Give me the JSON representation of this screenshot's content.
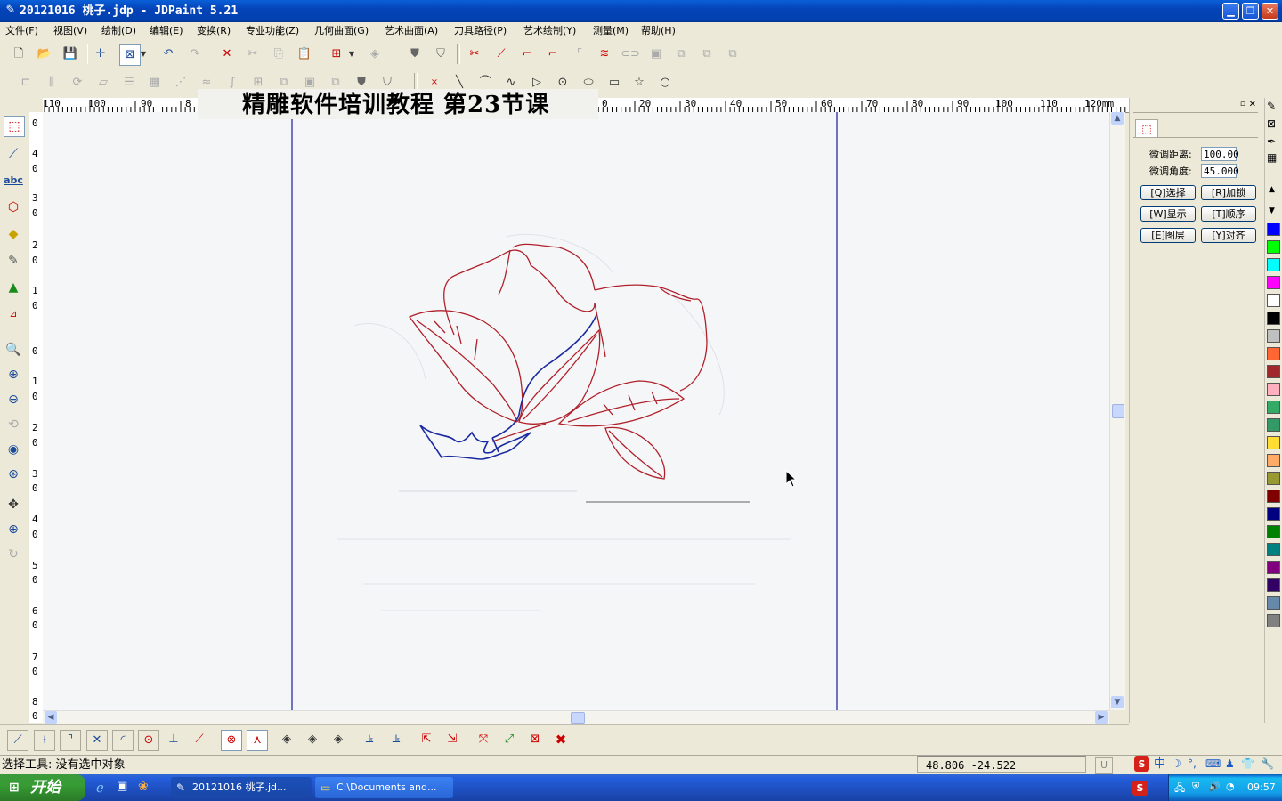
{
  "window": {
    "title": "20121016 桃子.jdp - JDPaint 5.21",
    "minimize_icon": "minimize-icon",
    "maximize_icon": "restore-icon",
    "close_icon": "close-icon"
  },
  "menu": [
    "文件(F)",
    "视图(V)",
    "绘制(D)",
    "编辑(E)",
    "变换(R)",
    "专业功能(Z)",
    "几何曲面(G)",
    "艺术曲面(A)",
    "刀具路径(P)",
    "艺术绘制(Y)",
    "测量(M)",
    "帮助(H)"
  ],
  "banner": {
    "text": "精雕软件培训教程  第23节课"
  },
  "hruler": {
    "labels": [
      "110",
      "100",
      "90",
      "8",
      "0",
      "20",
      "30",
      "40",
      "50",
      "60",
      "70",
      "80",
      "90",
      "100",
      "110",
      "120mm"
    ]
  },
  "vruler": {
    "labels": [
      "0",
      "4",
      "0",
      "3",
      "0",
      "2",
      "0",
      "1",
      "0",
      "0",
      "1",
      "0",
      "2",
      "0",
      "3",
      "0",
      "4",
      "0",
      "5",
      "0",
      "6",
      "0",
      "7",
      "0",
      "8",
      "0"
    ]
  },
  "right_panel": {
    "tab_icon": "select-node-icon",
    "fine_distance_label": "微调距离:",
    "fine_distance_value": "100.00",
    "fine_angle_label": "微调角度:",
    "fine_angle_value": "45.000",
    "buttons": [
      "[Q]选择",
      "[R]加锁",
      "[W]显示",
      "[T]顺序",
      "[E]图层",
      "[Y]对齐"
    ]
  },
  "palette": {
    "colors": [
      "#0000ff",
      "#ffffff",
      "#ff0000",
      "#ffff00",
      "#0000ff",
      "#00ff00",
      "#00ffff",
      "#ff00ff",
      "#ffffff",
      "#000000",
      "#c0c0c0",
      "#ff6633",
      "#a0282d",
      "#ffb0c0",
      "#33aa66",
      "#339966",
      "#ffdd33",
      "#ffaa66",
      "#999933",
      "#800000",
      "#000080",
      "#008000",
      "#008080",
      "#800080",
      "#330066",
      "#6688aa",
      "#808080"
    ]
  },
  "status": {
    "text": "选择工具: 没有选中对象",
    "coords": "48.806  -24.522"
  },
  "taskbar": {
    "start": "开始",
    "tasks": [
      "20121016 桃子.jd...",
      "C:\\Documents and..."
    ],
    "clock": "09:57"
  },
  "colors": {
    "title_bar": "#0a5fd8",
    "drawing_red": "#b0202a",
    "drawing_blue": "#1a2aa0",
    "guide_line": "#1a1aa0"
  }
}
